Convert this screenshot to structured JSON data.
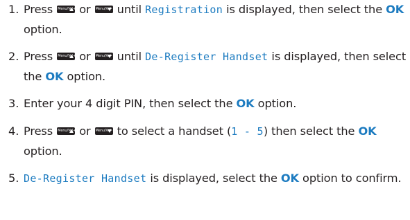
{
  "keys": {
    "up_label": "Menu/Vol+",
    "down_label": "Menu/Vol-"
  },
  "steps": [
    {
      "number": "1.",
      "press": "Press",
      "or": "or",
      "until": "until",
      "display": "Registration",
      "after_display": "is displayed, then select the",
      "ok": "OK",
      "end": "option."
    },
    {
      "number": "2.",
      "press": "Press",
      "or": "or",
      "until": "until",
      "display": "De-Register Handset",
      "after_display": "is displayed, then select the",
      "ok": "OK",
      "end": "option."
    },
    {
      "number": "3.",
      "text": "Enter your 4 digit PIN, then select the",
      "ok": "OK",
      "end": "option."
    },
    {
      "number": "4.",
      "press": "Press",
      "or": "or",
      "select_text": "to select a handset (",
      "range_start": "1",
      "range_sep": " - ",
      "range_end": "5",
      "after_range": ") then select the",
      "ok": "OK",
      "end": "option."
    },
    {
      "number": "5.",
      "display": "De-Register Handset",
      "after_display": "is displayed, select the",
      "ok": "OK",
      "end": "option to confirm."
    }
  ]
}
